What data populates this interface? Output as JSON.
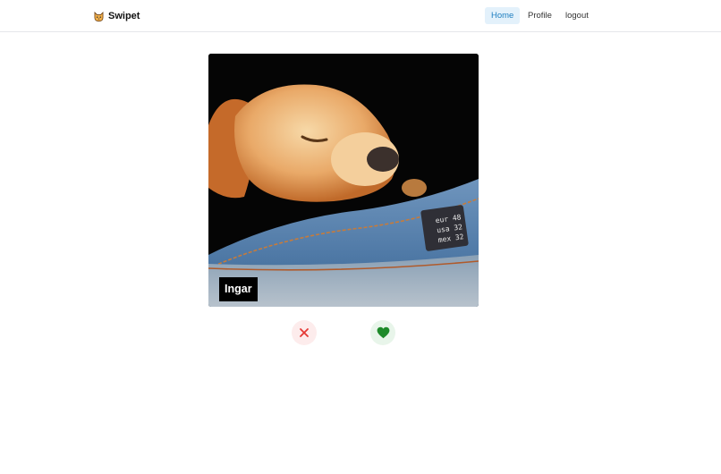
{
  "app": {
    "brand": "Swipet",
    "logo_icon": "cat-face-icon"
  },
  "nav": {
    "items": [
      {
        "label": "Home",
        "active": true
      },
      {
        "label": "Profile",
        "active": false
      },
      {
        "label": "logout",
        "active": false
      }
    ]
  },
  "card": {
    "pet_name": "Ingar",
    "photo_icon": "sleeping-puppy-photo",
    "jeans_tag": {
      "line1": "eur 48",
      "line2": "usa 32",
      "line3": "mex 32"
    }
  },
  "actions": {
    "dislike_icon": "close-icon",
    "like_icon": "heart-icon",
    "dislike_color": "#e53935",
    "like_color": "#1e8a2a"
  }
}
